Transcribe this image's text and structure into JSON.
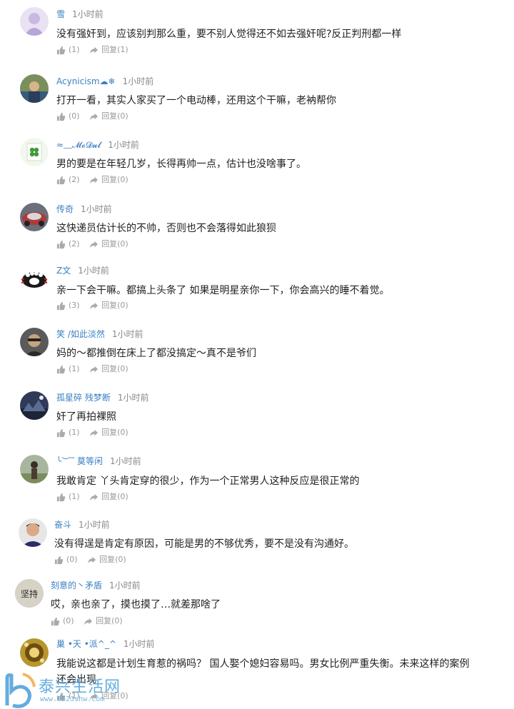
{
  "labels": {
    "reply": "回复"
  },
  "comments": [
    {
      "user": "雪",
      "time": "1小时前",
      "text": "没有强奸到，应该别判那么重，要不别人觉得还不如去强奸呢?反正判刑都一样",
      "likes": "(1)",
      "replies": "(1)"
    },
    {
      "user": "Acynicism☁❄",
      "time": "1小时前",
      "text": "打开一看，其实人家买了一个电动棒，还用这个干嘛，老衲帮你",
      "likes": "(0)",
      "replies": "(0)"
    },
    {
      "user": "≈﹏𝓜𝓸𝓓𝓾𝓵",
      "time": "1小时前",
      "text": "男的要是在年轻几岁，长得再帅一点，估计也没啥事了。",
      "likes": "(2)",
      "replies": "(0)"
    },
    {
      "user": "传奇",
      "time": "1小时前",
      "text": "这快递员估计长的不帅，否则也不会落得如此狼狈",
      "likes": "(2)",
      "replies": "(0)"
    },
    {
      "user": "Z文",
      "time": "1小时前",
      "text": "亲一下会干嘛。都搞上头条了 如果是明星亲你一下，你会高兴的睡不着觉。",
      "likes": "(3)",
      "replies": "(0)"
    },
    {
      "user": "笑 /如此淡然",
      "time": "1小时前",
      "text": "妈的～都推倒在床上了都没搞定～真不是爷们",
      "likes": "(1)",
      "replies": "(0)"
    },
    {
      "user": "孤星碎 残梦断",
      "time": "1小时前",
      "text": "奸了再拍裸照",
      "likes": "(1)",
      "replies": "(0)"
    },
    {
      "user": "╰︶‾ 莫等闲",
      "time": "1小时前",
      "text": "我敢肯定 丫头肯定穿的很少，作为一个正常男人这种反应是很正常的",
      "likes": "(1)",
      "replies": "(0)"
    },
    {
      "user": "奋斗",
      "time": "1小时前",
      "text": "没有得逞是肯定有原因，可能是男的不够优秀，要不是没有沟通好。",
      "likes": "(0)",
      "replies": "(0)"
    },
    {
      "user": "刻意的丶矛盾",
      "time": "1小时前",
      "text": "哎，亲也亲了，摸也摸了…就差那啥了",
      "likes": "(0)",
      "replies": "(0)",
      "avatar_text": "坚持"
    },
    {
      "user": "巢 •天 •派^_^",
      "time": "1小时前",
      "text": "我能说这都是计划生育惹的祸吗？ 国人娶个媳妇容易吗。男女比例严重失衡。未来这样的案例",
      "text2": "还会出现",
      "likes": "(1)",
      "replies": "(0)"
    }
  ],
  "watermark": {
    "title": "泰兴生活网",
    "url": "www.0523shw.com"
  },
  "colors": {
    "username": "#3a7fc1",
    "meta": "#888888",
    "action": "#999999",
    "watermark": "#4a9fd8"
  }
}
